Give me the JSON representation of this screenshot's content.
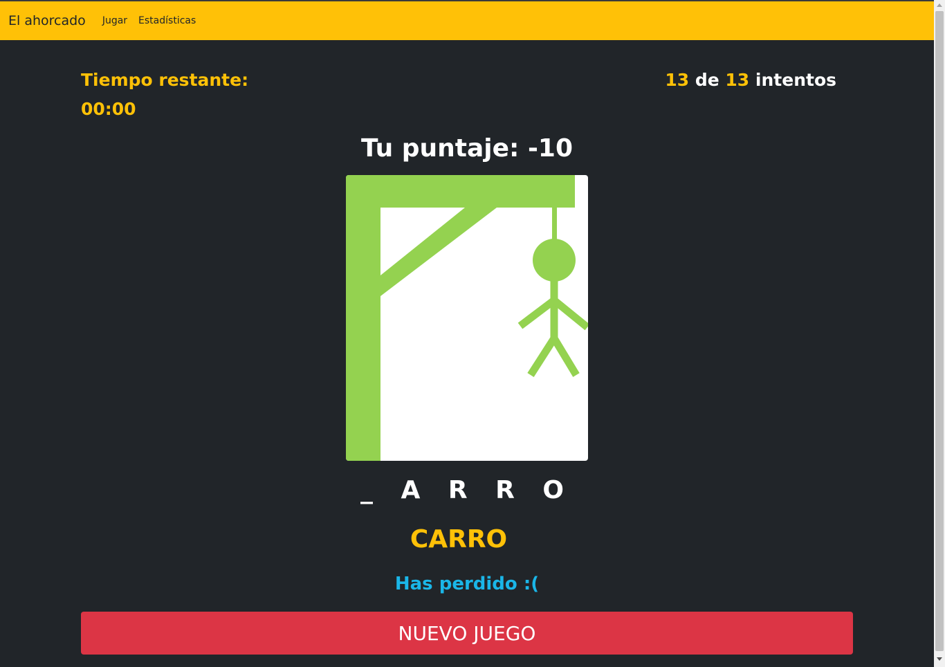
{
  "navbar": {
    "brand": "El ahorcado",
    "links": [
      "Jugar",
      "Estadísticas"
    ]
  },
  "timer": {
    "label": "Tiempo restante:",
    "value": "00:00"
  },
  "attempts": {
    "used": "13",
    "connector": "de",
    "total": "13",
    "suffix": "intentos"
  },
  "score": {
    "text": "Tu puntaje: -10"
  },
  "game": {
    "masked_word": "_ A R R O",
    "answer": "CARRO",
    "result": "Has perdido :(",
    "new_game_label": "NUEVO JUEGO"
  },
  "colors": {
    "navbar": "#ffc107",
    "background": "#212529",
    "accent_yellow": "#ffc107",
    "gallows_green": "#94d250",
    "result_blue": "#1ab6e8",
    "button_red": "#dc3545"
  },
  "icons": {
    "hangman_drawing": "hangman-icon"
  }
}
